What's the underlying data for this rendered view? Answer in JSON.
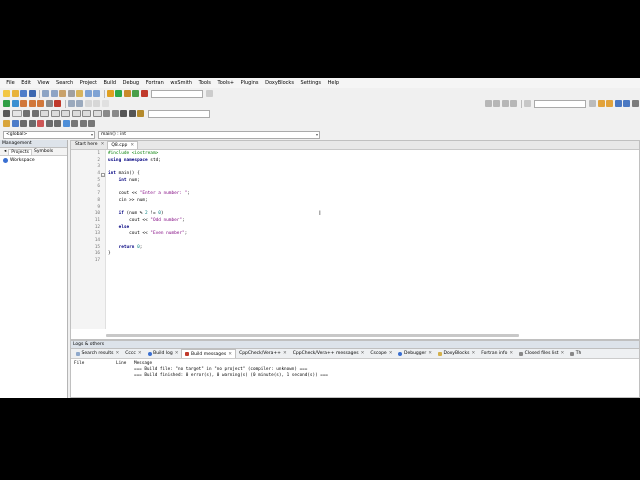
{
  "menu": [
    "File",
    "Edit",
    "View",
    "Search",
    "Project",
    "Build",
    "Debug",
    "Fortran",
    "wxSmith",
    "Tools",
    "Tools+",
    "Plugins",
    "DoxyBlocks",
    "Settings",
    "Help"
  ],
  "scope": {
    "global": "<global>",
    "function": "main() : int"
  },
  "management": {
    "title": "Management",
    "tabs": [
      "Projects",
      "Symbols"
    ],
    "workspace": "Workspace"
  },
  "editor": {
    "tabs": [
      {
        "label": "Start here",
        "close": "✕"
      },
      {
        "label": "Q8.cpp",
        "close": "✕"
      }
    ],
    "line_numbers": [
      "1",
      "2",
      "3",
      "4",
      "5",
      "6",
      "7",
      "8",
      "9",
      "10",
      "11",
      "12",
      "13",
      "14",
      "15",
      "16",
      "17"
    ],
    "caret_mark": "I"
  },
  "logs": {
    "title": "Logs & others",
    "tabs": [
      "Search results",
      "Cccc",
      "Build log",
      "Build messages",
      "CppCheck/Vera++",
      "CppCheck/Vera++ messages",
      "Cscope",
      "Debugger",
      "DoxyBlocks",
      "Fortran info",
      "Closed files list",
      "Th"
    ],
    "tab_close": "✕",
    "columns": {
      "file": "File",
      "line": "Line",
      "message": "Message"
    },
    "messages": [
      "=== Build file: \"no target\" in \"no project\" (compiler: unknown) ===",
      "=== Build finished: 0 error(s), 0 warning(s) (0 minute(s), 1 second(s)) ==="
    ]
  },
  "colors": {
    "keyword": "#00007f",
    "preprocessor": "#007f00",
    "string": "#7f007f",
    "number": "#007f7f"
  }
}
